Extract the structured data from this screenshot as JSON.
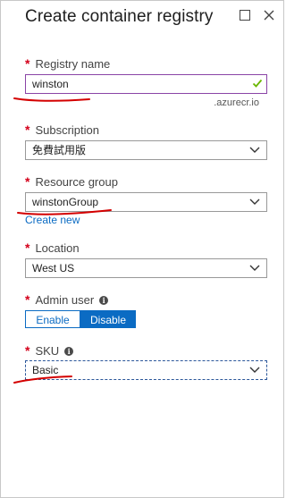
{
  "blade": {
    "title": "Create container registry"
  },
  "registry": {
    "label": "Registry name",
    "value": "winston",
    "suffix": ".azurecr.io"
  },
  "subscription": {
    "label": "Subscription",
    "value": "免費試用版"
  },
  "resource_group": {
    "label": "Resource group",
    "value": "winstonGroup",
    "create_new": "Create new"
  },
  "location": {
    "label": "Location",
    "value": "West US"
  },
  "admin_user": {
    "label": "Admin user",
    "enable": "Enable",
    "disable": "Disable",
    "selected": "Disable"
  },
  "sku": {
    "label": "SKU",
    "value": "Basic"
  },
  "required_mark": "*",
  "colors": {
    "accent": "#0b6bc3",
    "required": "#d4001a",
    "valid_check": "#6bb700",
    "annotation": "#d40000"
  }
}
